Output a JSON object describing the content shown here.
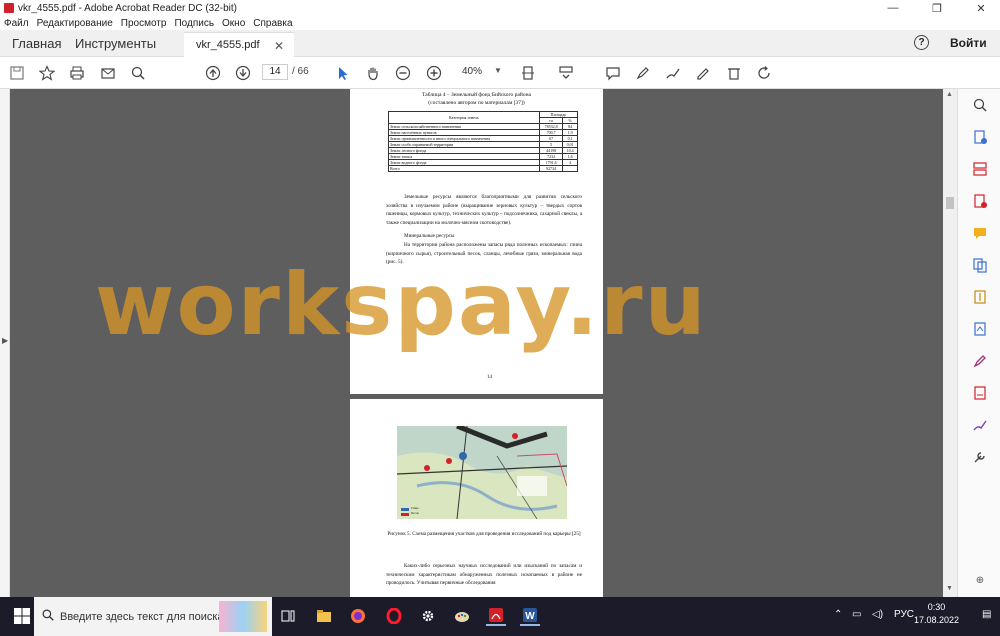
{
  "window": {
    "title": "vkr_4555.pdf - Adobe Acrobat Reader DC (32-bit)",
    "controls": {
      "minimize": "—",
      "restore": "❐",
      "close": "✕"
    }
  },
  "menubar": [
    "Файл",
    "Редактирование",
    "Просмотр",
    "Подпись",
    "Окно",
    "Справка"
  ],
  "tabs": {
    "home": "Главная",
    "tools": "Инструменты",
    "document": "vkr_4555.pdf",
    "close": "✕"
  },
  "header": {
    "help": "?",
    "login": "Войти"
  },
  "toolbar": {
    "page_current": "14",
    "page_total": "/ 66",
    "zoom": "40%"
  },
  "page1": {
    "table_title": "Таблица 4 – Земельный фонд Бийского района",
    "table_subtitle": "(составлено автором по материалам [37])",
    "table": {
      "header_category": "Категория земель",
      "header_area": "Площадь",
      "header_ha": "га",
      "header_pct": "%",
      "rows": [
        [
          "Земли сельскохозяйственного назначения",
          "78532,8",
          "84"
        ],
        [
          "Земли населённых пунктов",
          "700,7",
          "1,9"
        ],
        [
          "Земли промышленности и иного специального назначения",
          "67",
          "0,1"
        ],
        [
          "Земли особо охраняемой территории",
          "5",
          "0,01"
        ],
        [
          "Земли лесного фонда",
          "44198",
          "10,4"
        ],
        [
          "Земли запаса",
          "7232",
          "1,6"
        ],
        [
          "Земли водного фонда",
          "1791,6",
          "4"
        ],
        [
          "Всего",
          "92734",
          ""
        ]
      ]
    },
    "para1": "Земельные ресурсы являются благоприятными для развития сельского хозяйства в изучаемом районе (выращивание зерновых культур – твердых сортов пшеницы, кормовых культур, технических культур – подсолнечника, сахарной свеклы, а также специализации на молочно-мясном скотоводстве).",
    "heading": "Минеральные ресурсы",
    "para2": "На территории района расположены запасы ряда полезных ископаемых: глина (кирпичного сырья), строительный песок, сланцы, лечебные грязи, минеральная вода (рис. 5).",
    "page_number": "14"
  },
  "page2": {
    "legend_1": "Глина",
    "legend_2": "Песок",
    "figure_caption": "Рисунок 5. Схема размещения участков для проведения исследований под карьеры [25]",
    "para": "Каких-либо серьезных научных исследований или изысканий по запасам и техническим характеристикам обнаруженных полезных ископаемых в районе не проводилось. Учитывая первичные обследования"
  },
  "watermark": "workspay.ru",
  "taskbar": {
    "search_placeholder": "Введите здесь текст для поиска",
    "language": "РУС",
    "time": "0:30",
    "date": "17.08.2022"
  },
  "colors": {
    "acrobat_red": "#d3202a",
    "viewer_bg": "#5e5e5e",
    "watermark": "#d69628",
    "taskbar": "#1b1b2a"
  }
}
